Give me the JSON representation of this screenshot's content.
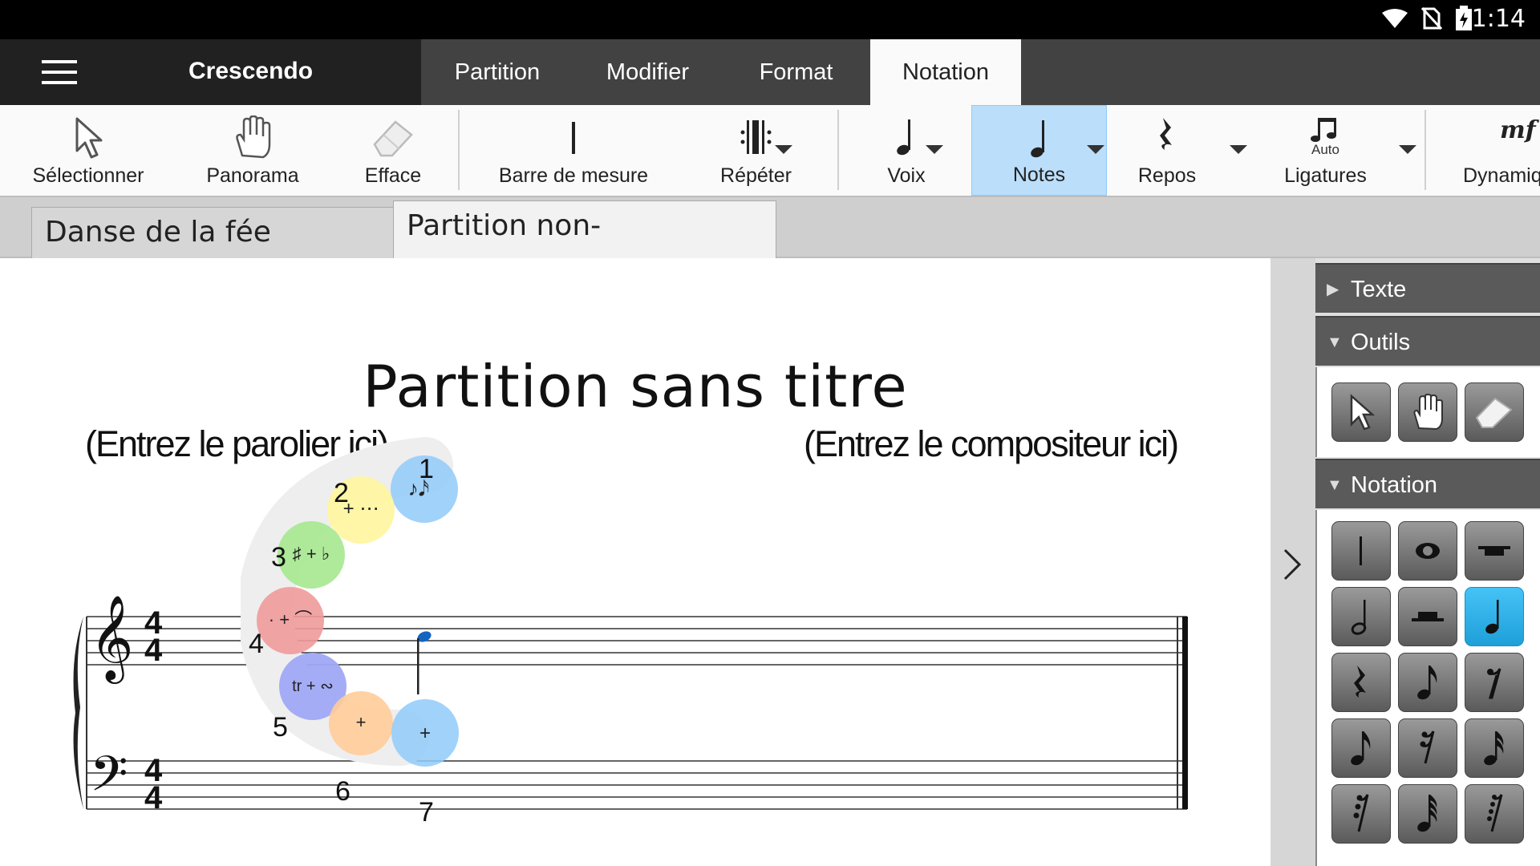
{
  "status": {
    "time": "1:14"
  },
  "app": {
    "name": "Crescendo"
  },
  "menu_tabs": [
    "Partition",
    "Modifier",
    "Format",
    "Notation"
  ],
  "toolbar": {
    "select": "Sélectionner",
    "pan": "Panorama",
    "erase": "Efface",
    "barline": "Barre de mesure",
    "repeat": "Répéter",
    "voice": "Voix",
    "notes": "Notes",
    "rests": "Repos",
    "beams": "Ligatures",
    "beams_icon_text": "Auto",
    "dynamics": "Dynamiq",
    "dynamics_icon_text": "mf"
  },
  "doc_tabs": [
    {
      "title": "Danse de la fée Dragée",
      "close": "✕"
    },
    {
      "title": "Partition non-enregistrée",
      "close": "✕"
    }
  ],
  "score": {
    "title": "Partition sans titre",
    "lyricist": "(Entrez le parolier ici)",
    "composer": "(Entrez le compositeur ici)",
    "time_top": "4",
    "time_bottom": "4",
    "wheel_numbers": [
      "1",
      "2",
      "3",
      "4",
      "5",
      "6",
      "7"
    ]
  },
  "side_panel": {
    "sections": [
      {
        "title": "Texte",
        "expanded": false
      },
      {
        "title": "Outils",
        "expanded": true
      },
      {
        "title": "Notation",
        "expanded": true
      }
    ]
  },
  "colors": {
    "accent": "#1e9fd8",
    "selected_tool": "#bbdefb",
    "note_blue": "#1565c0"
  }
}
